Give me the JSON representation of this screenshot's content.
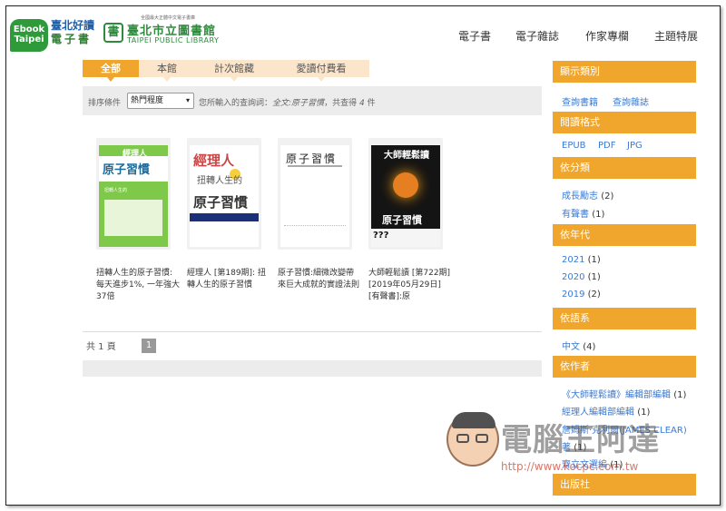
{
  "header": {
    "ebook_logo": "Ebook Taipei",
    "ebook_line1": "臺北好讀",
    "ebook_line2": "電子書",
    "library_small": "全國最大正體中文電子書庫",
    "library_name": "臺北市立圖書館",
    "library_en": "TAIPEI PUBLIC LIBRARY",
    "nav": [
      "電子書",
      "電子雜誌",
      "作家專欄",
      "主題特展"
    ]
  },
  "tabs": [
    "全部",
    "本館",
    "計次館藏",
    "愛讀付費看"
  ],
  "filter": {
    "sort_label": "排序條件",
    "sort_value": "熱門程度",
    "query_prefix": "您所輸入的查詢詞：",
    "query_value": "全文:原子習慣",
    "count_prefix": "，共查得",
    "count_value": "4",
    "count_suffix": "件"
  },
  "books": [
    {
      "title": "扭轉人生的原子習慣:每天進步1%, 一年強大37倍",
      "cover_top": "經理人",
      "cover_main": "扭轉人生的",
      "cover_sub": "原子習慣"
    },
    {
      "title": "經理人 [第189期]: 扭轉人生的原子習慣",
      "cover_top": "經理人",
      "cover_main": "扭轉人生的",
      "cover_sub": "原子習慣"
    },
    {
      "title": "原子習慣:細微改變帶來巨大成就的實證法則",
      "cover_top": "原子習慣",
      "cover_main": "",
      "cover_sub": ""
    },
    {
      "title": "大師輕鬆讀 [第722期] [2019年05月29日][有聲書]:原",
      "cover_top": "大師輕鬆讀",
      "cover_main": "原子習慣",
      "cover_sub": "???"
    }
  ],
  "pagination": {
    "total_label": "共 1 頁",
    "current": "1"
  },
  "sidebar": {
    "sections": [
      {
        "title": "顯示類別",
        "items": [
          {
            "label": "查詢書籍",
            "count": ""
          },
          {
            "label": "查詢雜誌",
            "count": ""
          }
        ]
      },
      {
        "title": "閱讀格式",
        "items": [
          {
            "label": "EPUB",
            "count": ""
          },
          {
            "label": "PDF",
            "count": ""
          },
          {
            "label": "JPG",
            "count": ""
          }
        ]
      },
      {
        "title": "依分類",
        "items": [
          {
            "label": "成長勵志",
            "count": "(2)"
          },
          {
            "label": "有聲書",
            "count": "(1)"
          }
        ]
      },
      {
        "title": "依年代",
        "items": [
          {
            "label": "2021",
            "count": "(1)"
          },
          {
            "label": "2020",
            "count": "(1)"
          },
          {
            "label": "2019",
            "count": "(2)"
          }
        ]
      },
      {
        "title": "依語系",
        "items": [
          {
            "label": "中文",
            "count": "(4)"
          }
        ]
      },
      {
        "title": "依作者",
        "items": [
          {
            "label": "《大師輕鬆讀》編輯部編輯",
            "count": "(1)"
          },
          {
            "label": "經理人編輯部編輯",
            "count": "(1)"
          },
          {
            "label": "詹姆斯‧克利爾(JAMES CLEAR)",
            "count": ""
          },
          {
            "label": "著",
            "count": "(1)"
          },
          {
            "label": "齊立文選編",
            "count": "(1)"
          }
        ]
      },
      {
        "title": "出版社",
        "items": []
      }
    ]
  },
  "watermark": {
    "text": "電腦王阿達",
    "url": "http://www.kocpc.com.tw"
  }
}
